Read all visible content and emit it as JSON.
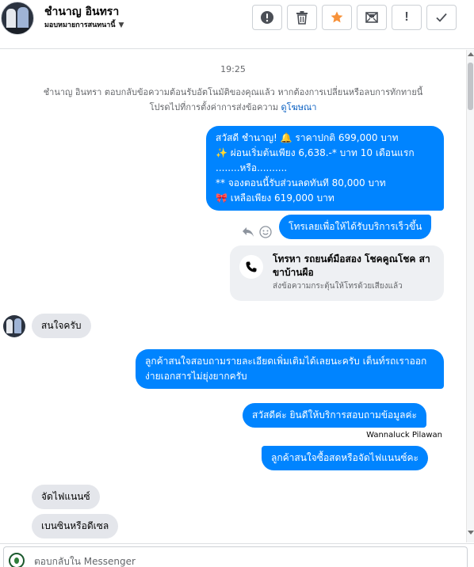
{
  "header": {
    "name": "ชำนาญ อินทรา",
    "assign_label": "มอบหมายการสนทนานี้",
    "toolbar": [
      {
        "icon": "exclamation-circle-icon"
      },
      {
        "icon": "trash-icon"
      },
      {
        "icon": "star-icon",
        "color": "#f7923a"
      },
      {
        "icon": "mail-icon"
      },
      {
        "icon": "exclamation-icon",
        "text": "!"
      },
      {
        "icon": "check-icon"
      }
    ]
  },
  "conversation": {
    "timestamp": "19:25",
    "system_note": {
      "line1": "ชำนาญ อินทรา ตอบกลับข้อความต้อนรับอัตโนมัติของคุณแล้ว หากต้องการเปลี่ยนหรือลบการทักทายนี้",
      "line2": "โปรดไปที่การตั้งค่าการส่งข้อความ",
      "link": "ดูโฆษณา"
    },
    "messages": {
      "promo": {
        "line1": "สวัสดี ชำนาญ! 🔔  ราคาปกติ  699,000 บาท",
        "line2": "✨  ผ่อนเริ่มต้นเพียง 6,638.-* บาท 10 เดือนแรก",
        "line3": "........หรือ..........",
        "line4": "** จองตอนนี้รับส่วนลดทันที 80,000 บาท",
        "line5": "🎀  เหลือเพียง 619,000 บาท"
      },
      "call_prompt": "โทรเลยเพื่อให้ได้รับบริการเร็วขึ้น",
      "call_card": {
        "title": "โทรหา รถยนต์มือสอง โชคคูณโชค สาขาบ้านผือ",
        "subtitle": "ส่งข้อความกระตุ้นให้โทรด้วยเสียงแล้ว"
      },
      "customer_interest": "สนใจครับ",
      "details_reply": "ลูกค้าสนใจสอบถามรายละเอียดเพิ่มเติมได้เลยนะครับ เต็นท์รถเราออกง่ายเอกสารไม่ยุ่งยากครับ",
      "greeting": "สวัสดีค่ะ  ยินดีให้บริการสอบถามข้อมูลค่ะ",
      "agent_name": "Wannaluck Pilawan",
      "question": "ลูกค้าสนใจซื้อสดหรือจัดไฟแนนซ์คะ",
      "customer_finance": "จัดไฟแนนซ์",
      "customer_fuel": "เบนซินหรือดีเซล"
    }
  },
  "composer": {
    "placeholder": "ตอบกลับใน Messenger"
  },
  "colors": {
    "outgoing_bubble": "#0084ff",
    "incoming_bubble": "#e4e6eb",
    "link": "#0a60c2",
    "star": "#f7923a"
  }
}
